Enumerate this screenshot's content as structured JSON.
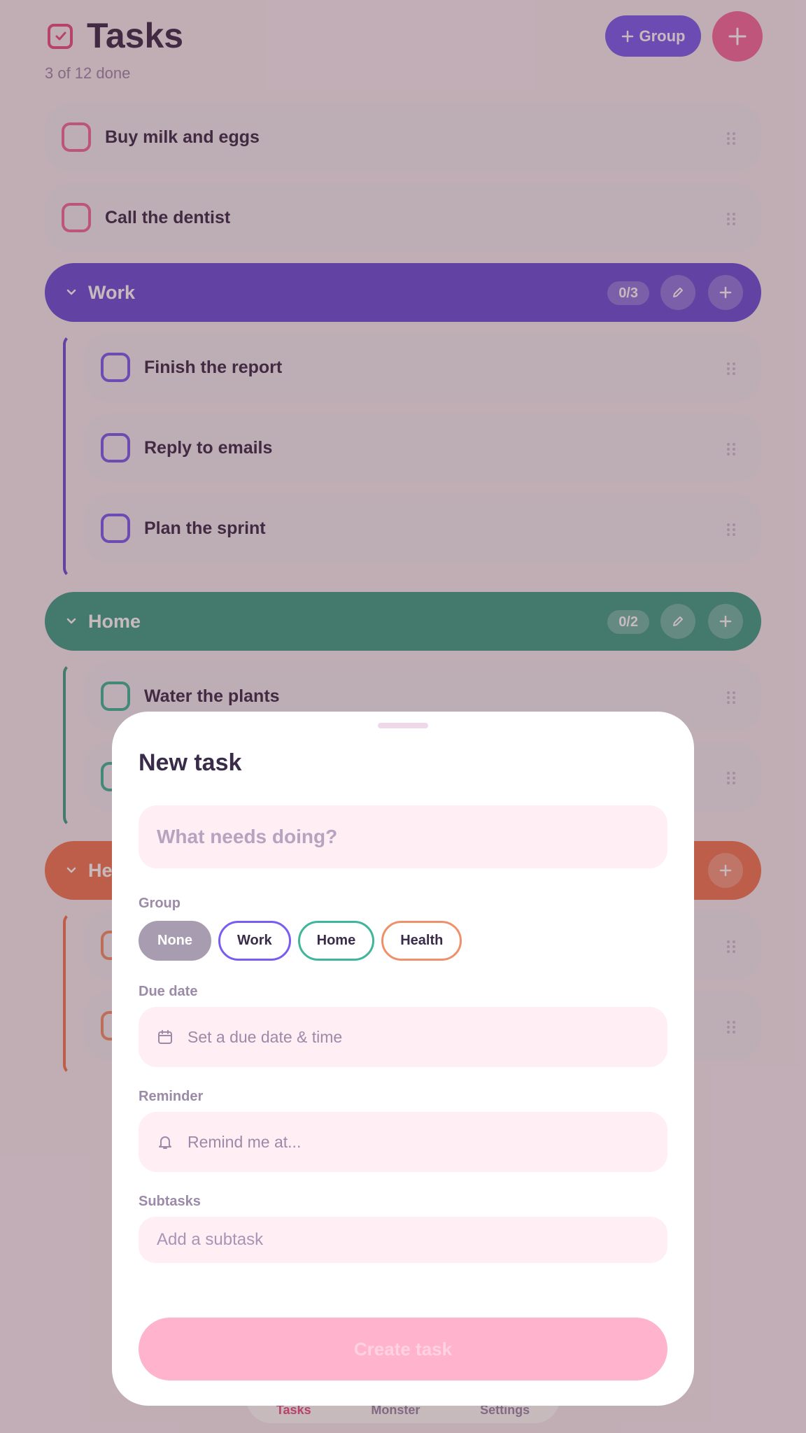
{
  "header": {
    "title": "Tasks",
    "progress_text": "3 of 12 done",
    "group_button": "Group",
    "add_icon": "plus-icon",
    "app_icon": "checkbox-icon"
  },
  "ungrouped_tasks": [
    {
      "label": "Buy milk and eggs"
    },
    {
      "label": "Call the dentist"
    }
  ],
  "groups": [
    {
      "name": "Work",
      "count": "0/3",
      "color": "#6b4fd8",
      "tasks": [
        {
          "label": "Finish the report"
        },
        {
          "label": "Reply to emails"
        },
        {
          "label": "Plan the sprint"
        }
      ]
    },
    {
      "name": "Home",
      "count": "0/2",
      "color": "#3fa08a",
      "tasks": [
        {
          "label": "Water the plants"
        }
      ]
    },
    {
      "name": "Health",
      "color": "#f07858"
    }
  ],
  "bottom_nav": [
    "Tasks",
    "Monster",
    "Settings"
  ],
  "sheet": {
    "title": "New task",
    "task_placeholder": "What needs doing?",
    "group_label": "Group",
    "group_chips": [
      {
        "label": "None",
        "selected": true
      },
      {
        "label": "Work",
        "color": "#7a5cf0"
      },
      {
        "label": "Home",
        "color": "#3fb59a"
      },
      {
        "label": "Health",
        "color": "#f0906a"
      }
    ],
    "due_label": "Due date",
    "due_placeholder": "Set a due date & time",
    "reminder_label": "Reminder",
    "reminder_placeholder": "Remind me at...",
    "subtasks_label": "Subtasks",
    "subtask_placeholder": "Add a subtask",
    "create_button": "Create task"
  }
}
